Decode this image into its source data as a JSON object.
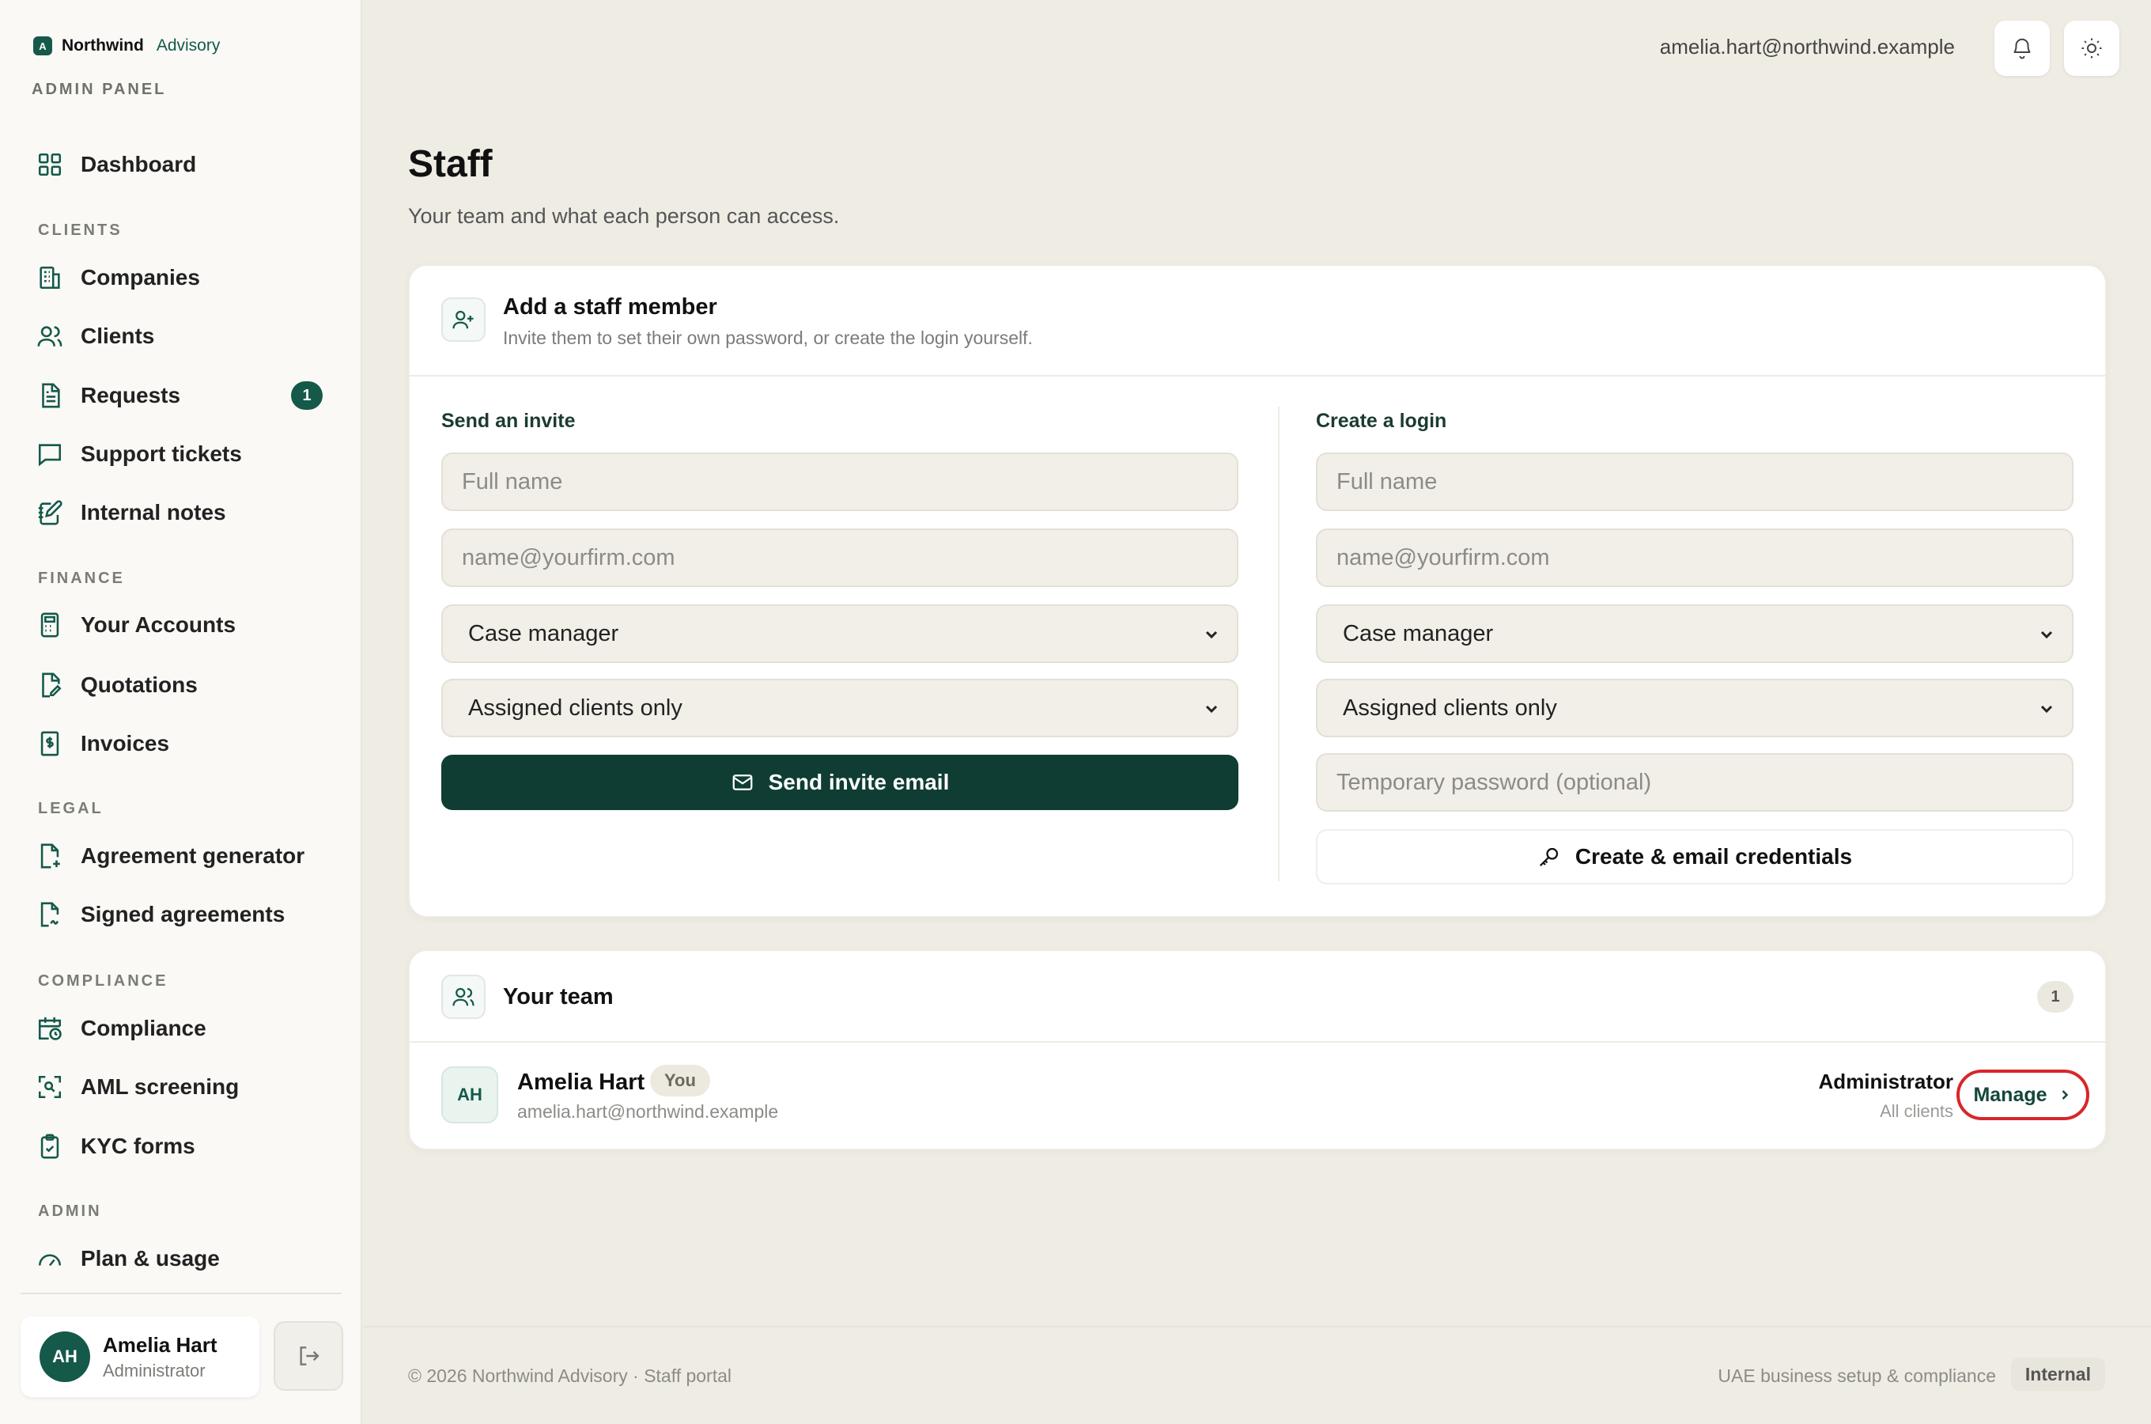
{
  "brand": {
    "mark": "A",
    "name": "Northwind",
    "sub": "Advisory",
    "panel_label": "ADMIN PANEL"
  },
  "nav": {
    "dashboard": "Dashboard",
    "sections": {
      "clients": "CLIENTS",
      "finance": "FINANCE",
      "legal": "LEGAL",
      "compliance": "COMPLIANCE",
      "admin": "ADMIN"
    },
    "items": {
      "companies": "Companies",
      "clients": "Clients",
      "requests": "Requests",
      "requests_badge": "1",
      "support_tickets": "Support tickets",
      "internal_notes": "Internal notes",
      "your_accounts": "Your Accounts",
      "quotations": "Quotations",
      "invoices": "Invoices",
      "agreement_generator": "Agreement generator",
      "signed_agreements": "Signed agreements",
      "compliance": "Compliance",
      "aml_screening": "AML screening",
      "kyc_forms": "KYC forms",
      "plan_usage": "Plan & usage"
    }
  },
  "sidebar_user": {
    "initials": "AH",
    "name": "Amelia Hart",
    "role": "Administrator"
  },
  "topbar": {
    "email": "amelia.hart@northwind.example",
    "icons": [
      "bell-icon",
      "sun-icon"
    ]
  },
  "page": {
    "title": "Staff",
    "subtitle": "Your team and what each person can access."
  },
  "add_staff": {
    "title": "Add a staff member",
    "description": "Invite them to set their own password, or create the login yourself.",
    "invite": {
      "heading": "Send an invite",
      "name_placeholder": "Full name",
      "email_placeholder": "name@yourfirm.com",
      "role_value": "Case manager",
      "access_value": "Assigned clients only",
      "button": "Send invite email"
    },
    "create": {
      "heading": "Create a login",
      "name_placeholder": "Full name",
      "email_placeholder": "name@yourfirm.com",
      "role_value": "Case manager",
      "access_value": "Assigned clients only",
      "password_placeholder": "Temporary password (optional)",
      "button": "Create & email credentials"
    }
  },
  "team": {
    "title": "Your team",
    "count": "1",
    "members": [
      {
        "initials": "AH",
        "name": "Amelia Hart",
        "badge": "You",
        "email": "amelia.hart@northwind.example",
        "role": "Administrator",
        "scope": "All clients",
        "action": "Manage"
      }
    ]
  },
  "footer": {
    "left": "© 2026 Northwind Advisory · Staff portal",
    "right": "UAE business setup & compliance",
    "badge": "Internal"
  },
  "colors": {
    "accent": "#14594a",
    "primary_button": "#0f3d33",
    "highlight": "#d8262a"
  }
}
